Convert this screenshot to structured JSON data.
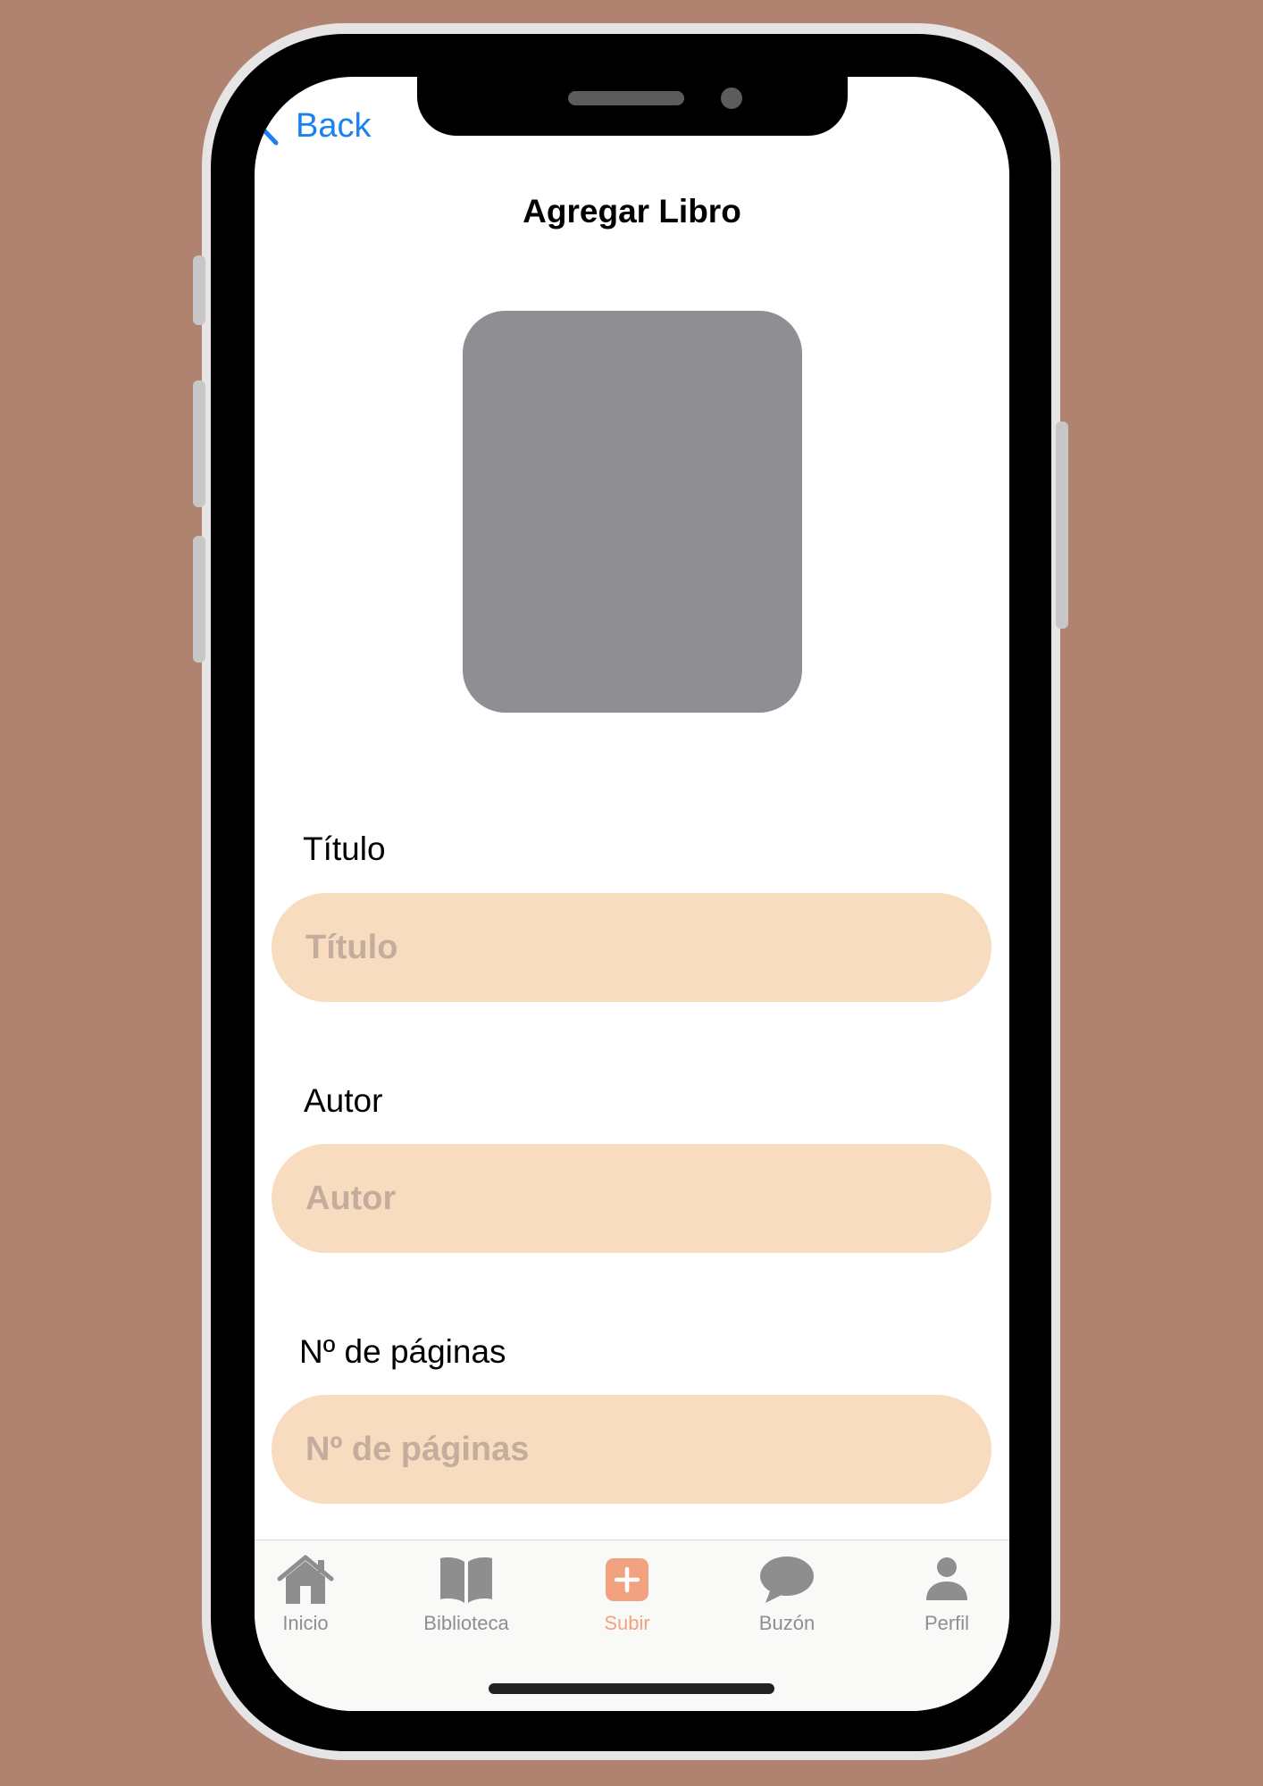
{
  "nav": {
    "back_label": "Back",
    "title": "Agregar Libro"
  },
  "form": {
    "fields": [
      {
        "label": "Título",
        "placeholder": "Título",
        "value": ""
      },
      {
        "label": "Autor",
        "placeholder": "Autor",
        "value": ""
      },
      {
        "label": "Nº de páginas",
        "placeholder": "Nº de páginas",
        "value": ""
      }
    ]
  },
  "tab_bar": {
    "tabs": [
      {
        "label": "Inicio",
        "icon": "house-icon",
        "active": false
      },
      {
        "label": "Biblioteca",
        "icon": "book-icon",
        "active": false
      },
      {
        "label": "Subir",
        "icon": "plus-square-icon",
        "active": true
      },
      {
        "label": "Buzón",
        "icon": "chat-bubble-icon",
        "active": false
      },
      {
        "label": "Perfil",
        "icon": "person-icon",
        "active": false
      }
    ]
  },
  "colors": {
    "background": "#b08270",
    "accent_link": "#1a82f0",
    "input_fill": "#f7dcc0",
    "placeholder_text": "#c4ad9c",
    "cover_placeholder": "#8f8f93",
    "active_tab": "#f3a27f",
    "inactive_tab": "#8e8e8e"
  }
}
